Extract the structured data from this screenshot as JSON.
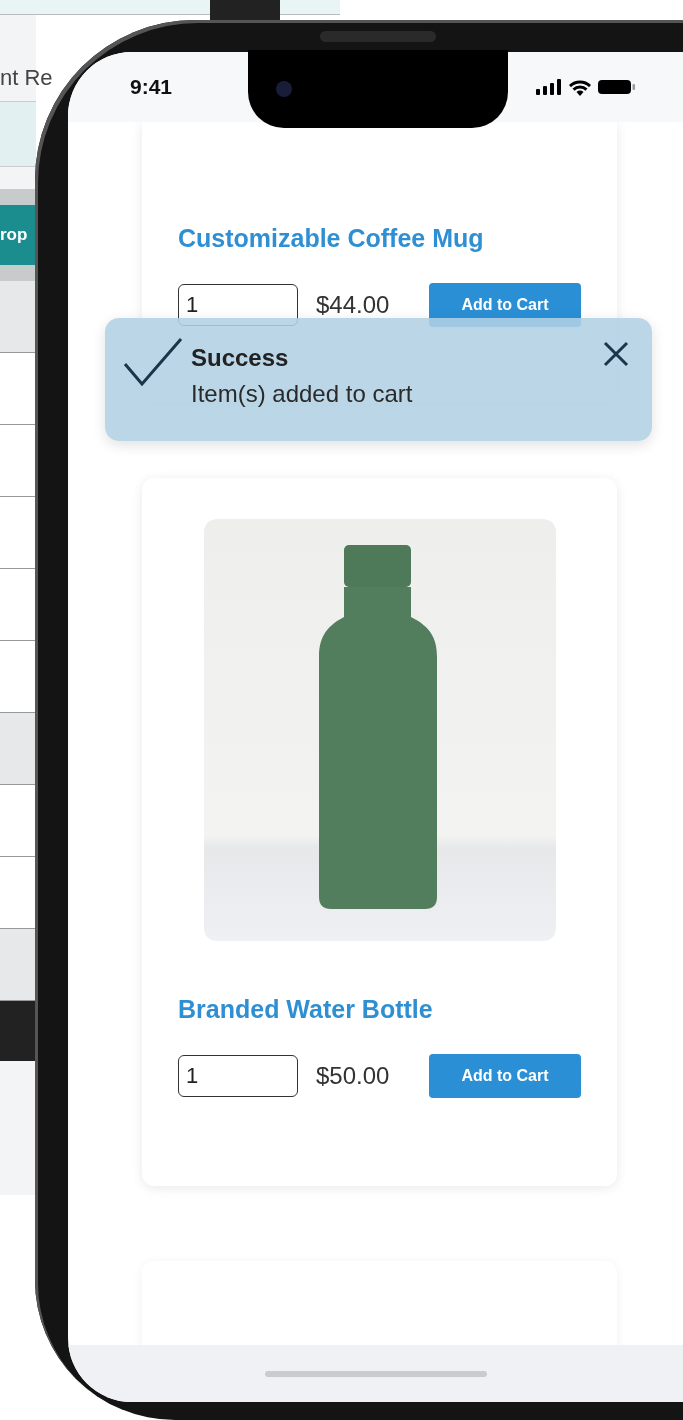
{
  "background_window": {
    "label": "nt Re",
    "button": "rop"
  },
  "status_bar": {
    "time": "9:41"
  },
  "products": [
    {
      "name": "Customizable Coffee Mug",
      "quantity": "1",
      "price": "$44.00",
      "button": "Add to Cart",
      "photo": false
    },
    {
      "name": "Branded Water Bottle",
      "quantity": "1",
      "price": "$50.00",
      "button": "Add to Cart",
      "photo": true
    }
  ],
  "toast": {
    "title": "Success",
    "message": "Item(s) added to cart"
  }
}
